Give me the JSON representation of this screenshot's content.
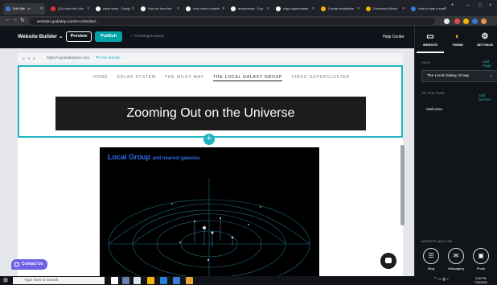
{
  "browser": {
    "tabs": [
      {
        "label": "Edit Site · 4 ·",
        "dot_color": "#3a7bd5",
        "active": true
      },
      {
        "label": "(24) How the Univ",
        "dot_color": "#e52d27",
        "active": false
      },
      {
        "label": "earth sizes · Googl",
        "dot_color": "#ffffff",
        "active": false
      },
      {
        "label": "How far from the",
        "dot_color": "#ffffff",
        "active": false
      },
      {
        "label": "how much of earth",
        "dot_color": "#ffffff",
        "active": false
      },
      {
        "label": "andromeda · Goo",
        "dot_color": "#ffffff",
        "active": false
      },
      {
        "label": "virgo supercluster",
        "dot_color": "#ffffff",
        "active": false
      },
      {
        "label": "Create installation",
        "dot_color": "#f2b705",
        "active": false
      },
      {
        "label": "Download Windo",
        "dot_color": "#f2b705",
        "active": false
      },
      {
        "label": "How to take a scre",
        "dot_color": "#3a7bd5",
        "active": false
      }
    ],
    "url": "websites.godaddy.com/en-US/editor/..."
  },
  "builder": {
    "title": "Website Builder",
    "preview_label": "Preview",
    "publish_label": "Publish",
    "saved_text": "✓ All changes saved",
    "help_label": "Help Center"
  },
  "panel": {
    "tabs": [
      {
        "label": "WEBSITE",
        "icon": "▭"
      },
      {
        "label": "THEME",
        "icon": "◐"
      },
      {
        "label": "SETTINGS",
        "icon": "⚙"
      }
    ],
    "page_section": "PAGE",
    "add_page": "Add Page",
    "selected_page": "The Local Galaxy Group",
    "on_this_page": "ON THIS PAGE",
    "add_section": "Add Section",
    "items": [
      "Welcome"
    ],
    "website_addons": "WEBSITE ADD-ONS",
    "addons": [
      {
        "label": "Blog",
        "icon": "☰"
      },
      {
        "label": "Messaging",
        "icon": "✉"
      },
      {
        "label": "Photo",
        "icon": "▣"
      }
    ]
  },
  "preview": {
    "domain": "https://v.godaddysites.com",
    "free_domain": "Free domain",
    "nav": [
      "HOME",
      "SOLAR SYSTEM",
      "THE MILKY WAY",
      "THE LOCAL GALAXY GROUP",
      "VIRGO SUPERCLUSTER"
    ],
    "current_nav": "THE LOCAL GALAXY GROUP",
    "banner_title": "Zooming Out on the Universe",
    "image_title": "Local Group",
    "image_subtitle": "and nearest galaxies"
  },
  "contact_label": "Contact Us",
  "taskbar": {
    "search_placeholder": "Type here to search",
    "time": "3:40 PM",
    "date": "7/15/2020"
  },
  "colors": {
    "accent": "#1fb5c0",
    "publish": "#00a4a6",
    "contact": "#6f62e6"
  }
}
